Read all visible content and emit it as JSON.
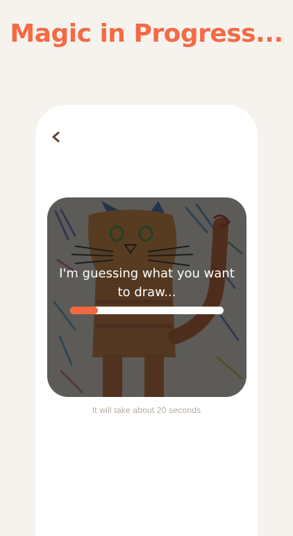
{
  "header": {
    "title": "Magic in Progress..."
  },
  "screen": {
    "back_icon": "chevron-left-icon",
    "status_message": "I'm guessing what you want to draw...",
    "progress_fraction": 0.18,
    "progress_color": "#f4673f",
    "eta_text": "It will take about 20 seconds"
  },
  "colors": {
    "accent": "#f46a45",
    "background": "#f6f3ee"
  }
}
